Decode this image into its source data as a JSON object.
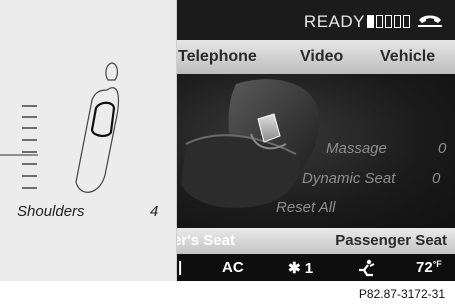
{
  "status": {
    "ready_text": "READY",
    "phone_icon": "phone-icon",
    "signal_icon": "signal-strength-icon"
  },
  "menu": {
    "items": [
      "Telephone",
      "Video",
      "Vehicle"
    ]
  },
  "seat_options": [
    {
      "label": "Massage",
      "value": "0"
    },
    {
      "label": "Dynamic Seat",
      "value": "0"
    },
    {
      "label": "Reset All",
      "value": ""
    }
  ],
  "seat_tabs": {
    "left": "er's Seat",
    "right": "Passenger Seat"
  },
  "climate": {
    "ac": "AC",
    "fan_icon": "fan-icon",
    "fan_level": "1",
    "airflow_icon": "airflow-icon",
    "temperature": "72",
    "temp_unit": "°F"
  },
  "panel": {
    "setting_label": "Shoulders",
    "setting_value": "4",
    "level": 4,
    "level_max": 7
  },
  "caption": "P82.87-3172-31",
  "colors": {
    "screen_bg": "#1a1a1a",
    "menu_bar": "#d0d0d0",
    "panel_bg": "#ececec"
  }
}
